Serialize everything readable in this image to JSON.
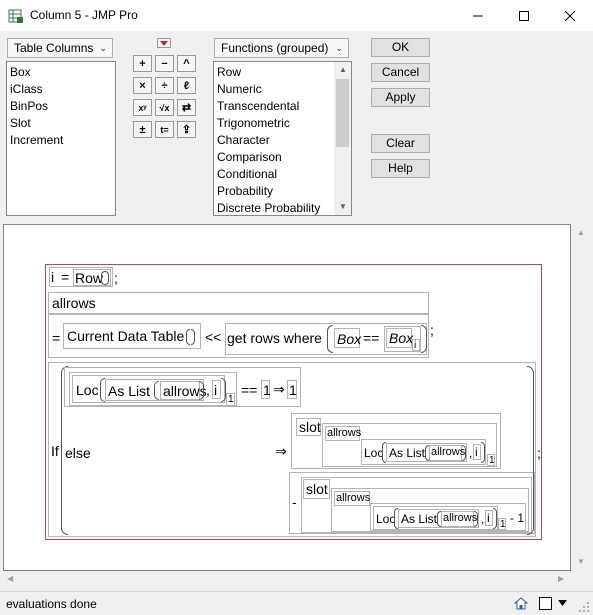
{
  "window": {
    "title": "Column 5 - JMP Pro",
    "app_icon": "jmp-table-icon",
    "controls": [
      "minimize-icon",
      "maximize-icon",
      "close-icon"
    ]
  },
  "table_columns": {
    "dropdown_label": "Table Columns",
    "items": [
      "Box",
      "iClass",
      "BinPos",
      "Slot",
      "Increment"
    ]
  },
  "functions": {
    "dropdown_label": "Functions (grouped)",
    "items": [
      "Row",
      "Numeric",
      "Transcendental",
      "Trigonometric",
      "Character",
      "Comparison",
      "Conditional",
      "Probability",
      "Discrete Probability"
    ]
  },
  "operators": {
    "menu_icon": "red-triangle-icon",
    "buttons": [
      {
        "icon": "plus-icon",
        "glyph": "+"
      },
      {
        "icon": "minus-icon",
        "glyph": "−"
      },
      {
        "icon": "caret-icon",
        "glyph": "^"
      },
      {
        "icon": "multiply-icon",
        "glyph": "×"
      },
      {
        "icon": "divide-icon",
        "glyph": "÷"
      },
      {
        "icon": "local-icon",
        "glyph": "ℓ"
      },
      {
        "icon": "power-icon",
        "glyph": "xʸ"
      },
      {
        "icon": "root-icon",
        "glyph": "√x"
      },
      {
        "icon": "swap-icon",
        "glyph": "⇄"
      },
      {
        "icon": "plusminus-icon",
        "glyph": "±"
      },
      {
        "icon": "assign-icon",
        "glyph": "t="
      },
      {
        "icon": "peel-icon",
        "glyph": "⇪"
      }
    ]
  },
  "buttons": {
    "ok": "OK",
    "cancel": "Cancel",
    "apply": "Apply",
    "clear": "Clear",
    "help": "Help"
  },
  "formula": {
    "line1": {
      "var": "i",
      "eq": "=",
      "fn": "Row",
      "semi": ";"
    },
    "allrows": "allrows",
    "assign_eq": "=",
    "current_data_table": "Current Data Table",
    "send_op": "<<",
    "get_rows_where": "get rows where",
    "box_left": "Box",
    "eqeq": "==",
    "box_right": "Box",
    "sub_i": "i",
    "semi2": ";",
    "if_label": "If",
    "loc": "Loc",
    "as_list": "As List",
    "allrows_arg": "allrows",
    "comma": ",",
    "i": "i",
    "sub_1": "1",
    "eqeq2": "==",
    "one": "1",
    "arrow": "⇒",
    "result1": "1",
    "slot": "slot",
    "else": "else",
    "minus": "-",
    "minus1": "- 1",
    "semi3": ";"
  },
  "status": {
    "text": "evaluations done",
    "icons": [
      "home-icon",
      "window-icon",
      "dropdown-arrow-icon"
    ]
  }
}
